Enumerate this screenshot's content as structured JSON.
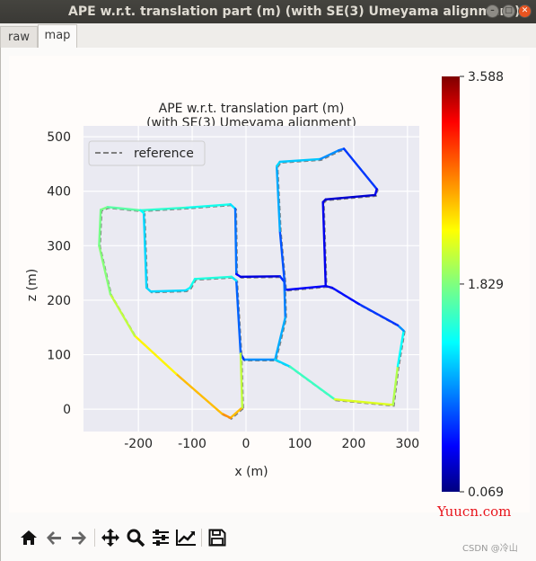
{
  "window": {
    "title": "APE w.r.t. translation part (m) (with SE(3) Umeyama alignment)",
    "buttons": [
      "minimize",
      "maximize",
      "close"
    ]
  },
  "tabs": [
    {
      "label": "raw",
      "active": false
    },
    {
      "label": "map",
      "active": true
    }
  ],
  "toolbar": {
    "icons": [
      "home-icon",
      "back-arrow-icon",
      "forward-arrow-icon",
      "pan-icon",
      "zoom-icon",
      "configure-subplots-icon",
      "edit-axis-icon",
      "save-icon"
    ]
  },
  "watermarks": {
    "site": "Yuucn.com",
    "author": "CSDN @冷山"
  },
  "chart_data": {
    "type": "line",
    "title": "APE w.r.t. translation part (m)",
    "subtitle": "(with SE(3) Umeyama alignment)",
    "xlabel": "x (m)",
    "ylabel": "z (m)",
    "xlim": [
      -302,
      322
    ],
    "ylim": [
      -41,
      520
    ],
    "xticks": [
      -200,
      -100,
      0,
      100,
      200,
      300
    ],
    "yticks": [
      0,
      100,
      200,
      300,
      400,
      500
    ],
    "grid": true,
    "legend": {
      "entries": [
        "reference"
      ],
      "placement": "top-left"
    },
    "reference_color": "#7f7f7f",
    "colormap": "jet",
    "colorbar": {
      "min": 0.069,
      "max": 3.588,
      "ticks": [
        "3.588",
        "1.829",
        "0.069"
      ]
    },
    "trajectory_segments": [
      [
        [
          -7,
          3,
          2.3
        ],
        [
          -29,
          -16,
          2.7
        ],
        [
          -45,
          -8,
          2.6
        ],
        [
          -130,
          65,
          2.4
        ],
        [
          -207,
          135,
          2.2
        ],
        [
          -252,
          211,
          1.9
        ],
        [
          -273,
          300,
          1.8
        ],
        [
          -270,
          366,
          1.8
        ],
        [
          -257,
          371,
          1.8
        ],
        [
          -196,
          365,
          1.6
        ],
        [
          -110,
          370,
          1.5
        ],
        [
          -29,
          376,
          1.4
        ],
        [
          -20,
          368,
          1.2
        ],
        [
          -18,
          248,
          0.6
        ],
        [
          -10,
          243,
          0.4
        ],
        [
          63,
          244,
          0.4
        ],
        [
          71,
          234,
          0.9
        ],
        [
          73,
          168,
          1.0
        ],
        [
          54,
          91,
          1.2
        ],
        [
          -4,
          91,
          0.8
        ],
        [
          -10,
          102,
          0.6
        ],
        [
          -18,
          236,
          1.1
        ],
        [
          -27,
          243,
          1.5
        ],
        [
          -95,
          239,
          1.5
        ],
        [
          -104,
          223,
          1.4
        ],
        [
          -112,
          218,
          1.3
        ],
        [
          -177,
          216,
          1.2
        ],
        [
          -185,
          223,
          1.3
        ],
        [
          -190,
          360,
          1.2
        ],
        [
          -196,
          365,
          1.6
        ]
      ],
      [
        [
          -7,
          3,
          2.3
        ],
        [
          -10,
          102,
          1.8
        ]
      ],
      [
        [
          54,
          91,
          1.2
        ],
        [
          82,
          78,
          1.3
        ],
        [
          165,
          18,
          1.9
        ],
        [
          273,
          8,
          2.4
        ],
        [
          282,
          79,
          1.6
        ],
        [
          293,
          144,
          1.2
        ],
        [
          282,
          154,
          0.8
        ],
        [
          210,
          193,
          0.6
        ],
        [
          160,
          223,
          0.5
        ],
        [
          148,
          226,
          0.4
        ],
        [
          73,
          219,
          0.6
        ],
        [
          63,
          327,
          1.0
        ],
        [
          57,
          446,
          1.2
        ],
        [
          63,
          454,
          1.3
        ],
        [
          138,
          459,
          1.1
        ],
        [
          172,
          475,
          0.9
        ],
        [
          182,
          478,
          0.9
        ],
        [
          243,
          404,
          0.5
        ],
        [
          240,
          393,
          0.4
        ],
        [
          148,
          385,
          0.3
        ],
        [
          143,
          380,
          0.4
        ],
        [
          148,
          228,
          0.5
        ]
      ]
    ]
  }
}
